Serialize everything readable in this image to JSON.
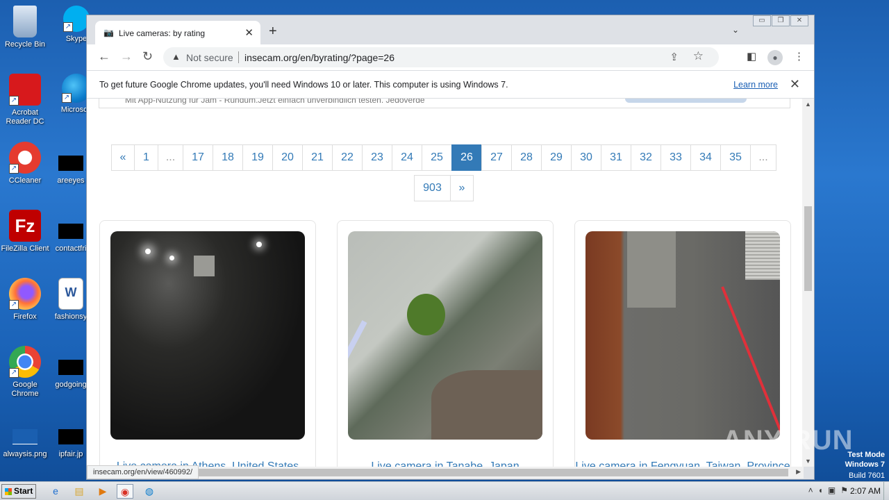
{
  "desktop": {
    "icons": [
      {
        "label": "Recycle Bin"
      },
      {
        "label": "Skype"
      },
      {
        "label": "Acrobat Reader DC"
      },
      {
        "label": "Microsoft"
      },
      {
        "label": "CCleaner"
      },
      {
        "label": "areeyes"
      },
      {
        "label": "FileZilla Client"
      },
      {
        "label": "contactfri"
      },
      {
        "label": "Firefox"
      },
      {
        "label": "fashionsy"
      },
      {
        "label": "Google Chrome"
      },
      {
        "label": "godgoing"
      },
      {
        "label": "alwaysis.png"
      },
      {
        "label": "ipfair.jp"
      }
    ],
    "watermark": "ANY RUN",
    "testmode": {
      "line1": "Test Mode",
      "line2": "Windows 7",
      "line3": "Build 7601"
    }
  },
  "browser": {
    "tab_title": "Live cameras: by rating",
    "tab_close": "✕",
    "new_tab": "+",
    "tab_menu": "⌄",
    "window_buttons": [
      "▭",
      "❐",
      "✕"
    ],
    "not_secure": "Not secure",
    "url": "insecam.org/en/byrating/?page=26",
    "infobar_message": "To get future Google Chrome updates, you'll need Windows 10 or later. This computer is using Windows 7.",
    "learn_more": "Learn more",
    "status_url": "insecam.org/en/view/460992/"
  },
  "page": {
    "cutoff_text": "Mit App-Nutzung für Jam - Rundum.Jetzt einfach unverbindlich testen. Jedoverde",
    "pagination_row1": [
      {
        "label": "«",
        "w": 34
      },
      {
        "label": "1",
        "w": 35
      },
      {
        "label": "...",
        "w": 37,
        "dim": true
      },
      {
        "label": "17",
        "w": 44
      },
      {
        "label": "18",
        "w": 44
      },
      {
        "label": "19",
        "w": 44
      },
      {
        "label": "20",
        "w": 44
      },
      {
        "label": "21",
        "w": 44
      },
      {
        "label": "22",
        "w": 44
      },
      {
        "label": "23",
        "w": 44
      },
      {
        "label": "24",
        "w": 44
      },
      {
        "label": "25",
        "w": 44
      },
      {
        "label": "26",
        "w": 44,
        "active": true
      },
      {
        "label": "27",
        "w": 44
      },
      {
        "label": "28",
        "w": 44
      },
      {
        "label": "29",
        "w": 44
      },
      {
        "label": "30",
        "w": 44
      },
      {
        "label": "31",
        "w": 44
      },
      {
        "label": "32",
        "w": 44
      },
      {
        "label": "33",
        "w": 44
      },
      {
        "label": "34",
        "w": 44
      },
      {
        "label": "35",
        "w": 44
      },
      {
        "label": "...",
        "w": 38,
        "dim": true
      }
    ],
    "pagination_row2": [
      {
        "label": "903",
        "w": 53
      },
      {
        "label": "»",
        "w": 34
      }
    ],
    "cameras": [
      {
        "label": "Live camera in Athens, United States"
      },
      {
        "label": "Live camera in Tanabe, Japan"
      },
      {
        "label": "Live camera in Fengyuan, Taiwan, Province Of"
      }
    ]
  },
  "taskbar": {
    "start": "Start",
    "time": "2:07 AM"
  }
}
